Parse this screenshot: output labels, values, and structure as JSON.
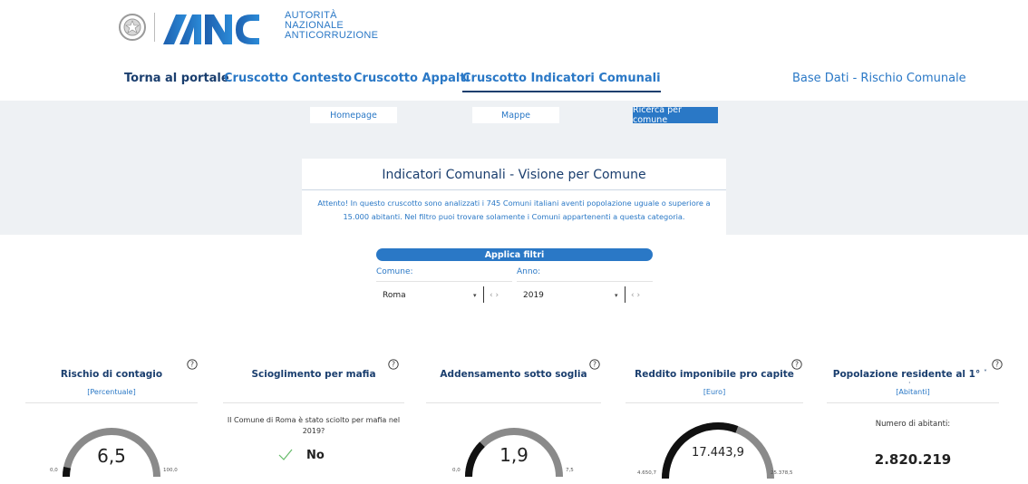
{
  "header": {
    "logo_text": [
      "AUTORITÀ",
      "NAZIONALE",
      "ANTICORRUZIONE"
    ],
    "emblem_icon": "italian-republic-emblem",
    "anac_logo": "ANAC"
  },
  "nav": {
    "items": [
      "Torna al portale",
      "Cruscotto Contesto",
      "Cruscotto Appalti",
      "Cruscotto Indicatori Comunali"
    ],
    "active": "Cruscotto Indicatori Comunali",
    "right": "Base Dati - Rischio Comunale"
  },
  "subnav": {
    "buttons": [
      "Homepage",
      "Mappe",
      "Ricerca per comune"
    ],
    "selected": "Ricerca per comune"
  },
  "intro": {
    "title": "Indicatori Comunali - Visione per Comune",
    "note_line1": "Attento! In questo cruscotto sono analizzati i 745 Comuni italiani aventi popolazione uguale o superiore a",
    "note_line2": "15.000 abitanti. Nel filtro puoi trovare solamente i Comuni appartenenti a questa categoria."
  },
  "filters": {
    "header": "Applica filtri",
    "comune_label": "Comune:",
    "comune_value": "Roma",
    "anno_label": "Anno:",
    "anno_value": "2019",
    "caret": "▾",
    "arrows": "‹ ›"
  },
  "kpis": {
    "contagio": {
      "title": "Rischio di contagio",
      "unit": "[Percentuale]",
      "value": "6,5",
      "min": "0,0",
      "max": "100,0",
      "fraction": 0.065
    },
    "mafia": {
      "title": "Scioglimento per mafia",
      "text": "Il Comune di Roma è stato sciolto per mafia nel 2019?",
      "answer": "No",
      "icon": "check-icon"
    },
    "addensamento": {
      "title": "Addensamento sotto soglia",
      "value": "1,9",
      "min": "0,0",
      "max": "7,5",
      "fraction": 0.253
    },
    "reddito": {
      "title": "Reddito imponibile pro capite",
      "unit": "[Euro]",
      "value": "17.443,9",
      "min": "4.650,7",
      "max": "25.378,5",
      "fraction": 0.617
    },
    "popolazione": {
      "title": "Popolazione residente al 1°",
      "unit": "[Abitanti]",
      "label": "Numero di abitanti:",
      "value": "2.820.219"
    }
  },
  "colors": {
    "primary": "#2a78c6",
    "navy": "#1a3e6e",
    "gauge_fill": "#111111",
    "gauge_track": "#8a8a8a",
    "check": "#66bb6a"
  }
}
